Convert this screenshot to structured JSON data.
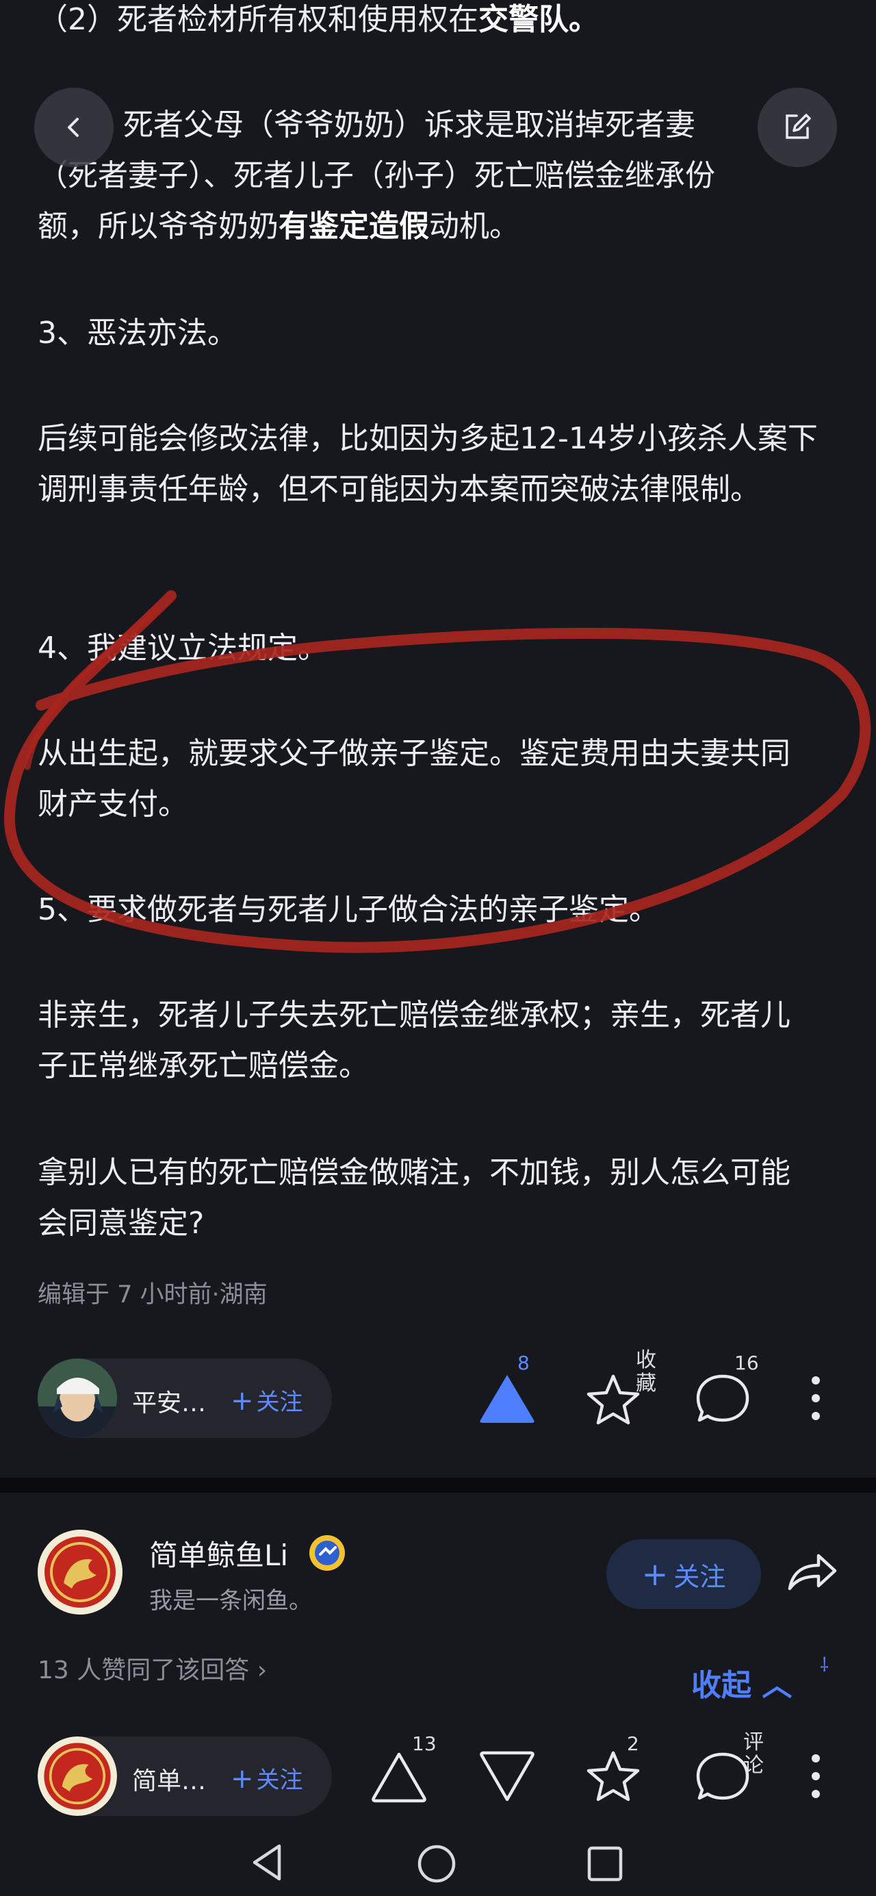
{
  "article": {
    "line_top": "（2）死者检材所有权和使用权在",
    "line_top_bold": "交警队。",
    "p_parents_a": "死者父母（爷爷奶奶）诉求是取消掉死者妻",
    "p_parents_b": "（死者妻子）、死者儿子（孙子）死亡赔偿金继承份",
    "p_parents_c": "额，所以爷爷奶奶",
    "p_parents_bold": "有鉴定造假",
    "p_parents_end": "动机。",
    "p3": "3、恶法亦法。",
    "p_law": "后续可能会修改法律，比如因为多起12-14岁小孩杀人案下调刑事责任年龄，但不可能因为本案而突破法律限制。",
    "p4": "4、我建议立法规定。",
    "p_birth": "从出生起，就要求父子做亲子鉴定。鉴定费用由夫妻共同财产支付。",
    "p5": "5、要求做死者与死者儿子做合法的亲子鉴定。",
    "p_nonbio": "非亲生，死者儿子失去死亡赔偿金继承权；亲生，死者儿子正常继承死亡赔偿金。",
    "p_bet": "拿别人已有的死亡赔偿金做赌注，不加钱，别人怎么可能会同意鉴定?",
    "meta": "编辑于 7 小时前·湖南"
  },
  "action_bar_1": {
    "user_name": "平安…",
    "follow_label": "关注",
    "upvote_count": "8",
    "collect_label": "收藏",
    "comment_count": "16"
  },
  "answer_2": {
    "author": "简单鲸鱼Li",
    "bio": "我是一条闲鱼。",
    "follow_label": "关注",
    "agree_text": "13 人赞同了该回答",
    "collapse_label": "收起"
  },
  "action_bar_2": {
    "user_name": "简单…",
    "follow_label": "关注",
    "upvote_count": "13",
    "favorite_count": "2",
    "comment_label": "评论"
  },
  "colors": {
    "background": "#17171e",
    "accent": "#4f7fff",
    "annotation_red": "#a8261e"
  }
}
